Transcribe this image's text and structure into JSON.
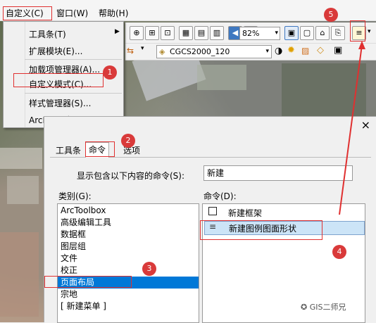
{
  "menubar": {
    "items": [
      {
        "label": "自定义(C)"
      },
      {
        "label": "窗口(W)"
      },
      {
        "label": "帮助(H)"
      }
    ]
  },
  "toolbar": {
    "zoom_value": "82%",
    "coord_system": "CGCS2000_120"
  },
  "dropdown": {
    "items": [
      {
        "label": "工具条(T)"
      },
      {
        "label": "扩展模块(E)..."
      },
      {
        "label": "加载项管理器(A)..."
      },
      {
        "label": "自定义模式(C)..."
      },
      {
        "label": "样式管理器(S)..."
      },
      {
        "label": "ArcMap 选项(O)..."
      }
    ]
  },
  "dialog": {
    "close_glyph": "×",
    "tabs": [
      {
        "label": "工具条"
      },
      {
        "label": "命令"
      },
      {
        "label": "选项"
      }
    ],
    "filter_label": "显示包含以下内容的命令(S):",
    "filter_value": "新建",
    "categories_label": "类别(G):",
    "commands_label": "命令(D):",
    "categories": [
      "ArcToolbox",
      "高级编辑工具",
      "数据框",
      "图层组",
      "文件",
      "校正",
      "页面布局",
      "宗地",
      "[ 新建菜单 ]"
    ],
    "selected_category": "页面布局",
    "commands": [
      {
        "label": "新建框架"
      },
      {
        "label": "新建图例图面形状"
      }
    ]
  },
  "annotations": {
    "badges": [
      "1",
      "2",
      "3",
      "4",
      "5"
    ],
    "watermark": "GIS二师兄"
  }
}
